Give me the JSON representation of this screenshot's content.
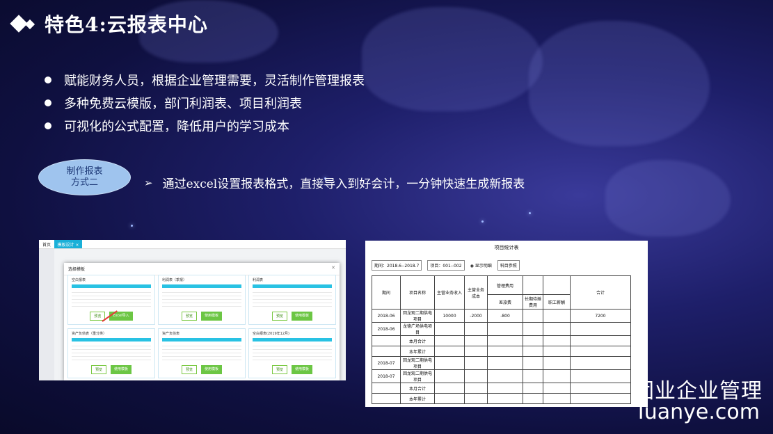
{
  "title": "特色4:云报表中心",
  "bullets": [
    "赋能财务人员，根据企业管理需要，灵活制作管理报表",
    "多种免费云模版，部门利润表、项目利润表",
    "可视化的公式配置，降低用户的学习成本"
  ],
  "method_badge": {
    "line1": "制作报表",
    "line2": "方式二"
  },
  "method_text": "通过excel设置报表格式，直接导入到好会计，一分钟快速生成新报表",
  "screenshot1": {
    "tab_home": "首页",
    "tab_active": "模板设计 ×",
    "modal_title": "选择模板",
    "cards": [
      {
        "title": "空白报表",
        "btn1": "预览",
        "btn2": "Excel导入"
      },
      {
        "title": "利润表（季报）",
        "btn1": "预览",
        "btn2": "使用模板"
      },
      {
        "title": "利润表",
        "btn1": "预览",
        "btn2": "使用模板"
      },
      {
        "title": "资产负债表（重分类）",
        "btn1": "预览",
        "btn2": "使用模板"
      },
      {
        "title": "资产负债表",
        "btn1": "预览",
        "btn2": "使用模板"
      },
      {
        "title": "空白报表(2019年12月)",
        "btn1": "预览",
        "btn2": "使用模板"
      }
    ]
  },
  "screenshot2": {
    "title": "项目统计表",
    "period": "期间：2018.6--2018.7",
    "project": "项目：001--002",
    "show_detail": "◉ 显示明细",
    "subject": "科目参照",
    "headers": [
      "期间",
      "项目名称",
      "主营业务收入",
      "主营业务成本",
      "管理费用",
      "",
      "",
      "合计"
    ],
    "subheaders": [
      "差旅费",
      "长期待摊费用",
      "职工薪酬"
    ],
    "rows": [
      [
        "2018-06",
        "回龙观二期供电项目",
        "10000",
        "-2000",
        "-800",
        "",
        "",
        "7200"
      ],
      [
        "2018-06",
        "龙德广场供电项目",
        "",
        "",
        "",
        "",
        "",
        ""
      ],
      [
        "",
        "本月合计",
        "",
        "",
        "",
        "",
        "",
        ""
      ],
      [
        "",
        "本年累计",
        "",
        "",
        "",
        "",
        "",
        ""
      ],
      [
        "2018-07",
        "回龙观二期供电项目",
        "",
        "",
        "",
        "",
        "",
        ""
      ],
      [
        "2018-07",
        "回龙观二期供电项目",
        "",
        "",
        "",
        "",
        "",
        ""
      ],
      [
        "",
        "本月合计",
        "",
        "",
        "",
        "",
        "",
        ""
      ],
      [
        "",
        "本年累计",
        "",
        "",
        "",
        "",
        "",
        ""
      ]
    ]
  },
  "brand": {
    "line1": "团业企业管理",
    "line2": "Tuanye.com"
  }
}
